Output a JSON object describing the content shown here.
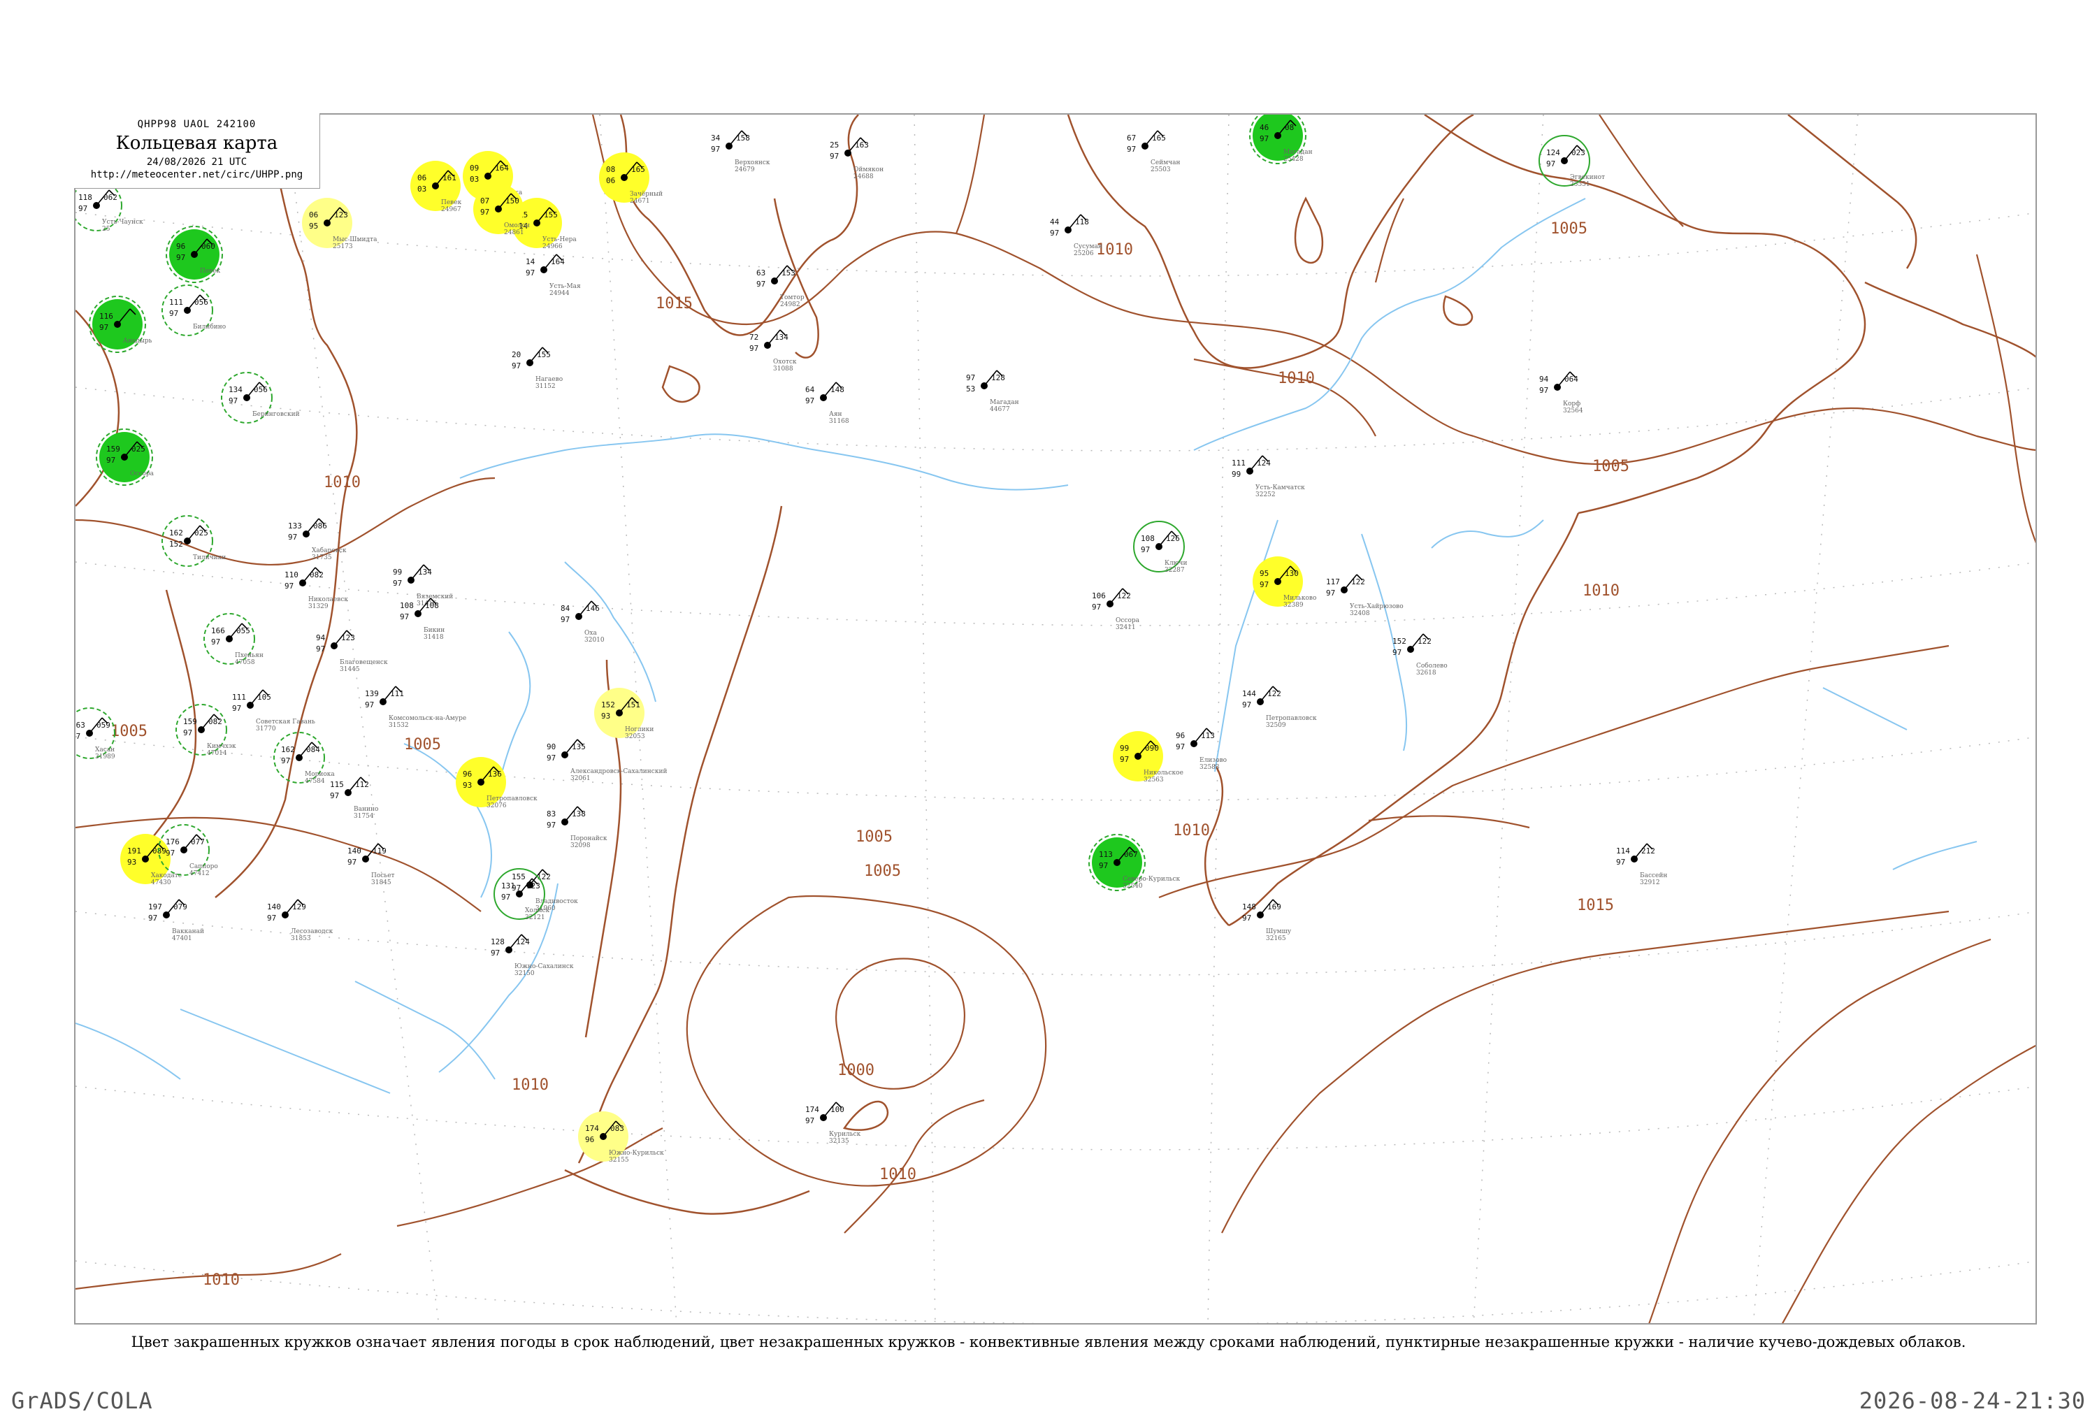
{
  "header": {
    "code": "QHPP98  UAOL  242100",
    "title": "Кольцевая карта",
    "valid_time": "24/08/2026 21 UTC",
    "url": "http://meteocenter.net/circ/UHPP.png"
  },
  "caption": "Цвет закрашенных кружков означает явления погоды в срок наблюдений, цвет незакрашенных кружков - конвективные явления между сроками наблюдений, пунктирные незакрашенные кружки - наличие кучево-дождевых облаков.",
  "footer": {
    "left": "GrADS/COLA",
    "right": "2026-08-24-21:30"
  },
  "colors": {
    "isobar": "#a0522d",
    "coast": "#a0522d",
    "river": "#87c6f0",
    "grid": "#b8b8b8",
    "rain_fill": "#1ec81e",
    "shower_fill": "#ffff2a",
    "light_fill": "#ffff88",
    "cb_dash": "#2ea82e"
  },
  "isobar_labels": [
    "1015",
    "1015",
    "1010",
    "1010",
    "1010",
    "1010",
    "1010",
    "1005",
    "1005",
    "1005",
    "1005",
    "1010",
    "1015",
    "1010",
    "1000",
    "1005",
    "1010",
    "1005",
    "1010"
  ],
  "stations": [
    {
      "name": "Усть-Чаунск",
      "id": "25",
      "t": "118",
      "p": "062",
      "td": "97"
    },
    {
      "name": "Певек",
      "id": "",
      "t": "96",
      "p": "060",
      "td": "97"
    },
    {
      "name": "Билибино",
      "id": "",
      "t": "111",
      "p": "056",
      "td": "97"
    },
    {
      "name": "Анадырь",
      "id": "",
      "t": "116",
      "p": "",
      "td": "97"
    },
    {
      "name": "Беринговский",
      "id": "",
      "t": "134",
      "p": "056",
      "td": "97"
    },
    {
      "name": "Тиличики",
      "id": "",
      "t": "162",
      "p": "025",
      "td": "152"
    },
    {
      "name": "Оссора",
      "id": "",
      "t": "159",
      "p": "025",
      "td": "97"
    },
    {
      "name": "Мыс Шмидта",
      "id": "25173",
      "t": "06",
      "p": "123",
      "td": "95"
    },
    {
      "name": "Певек",
      "id": "24967",
      "t": "06",
      "p": "161",
      "td": "03"
    },
    {
      "name": "Зырянка",
      "id": "24962",
      "t": "09",
      "p": "164",
      "td": "03"
    },
    {
      "name": "Усть-Нера",
      "id": "24966",
      "t": "15",
      "p": "155",
      "td": "14"
    },
    {
      "name": "Зачёрный",
      "id": "24671",
      "t": "08",
      "p": "165",
      "td": "06"
    },
    {
      "name": "Верхоянск",
      "id": "24679",
      "t": "34",
      "p": "158",
      "td": "97"
    },
    {
      "name": "Оймякон",
      "id": "24688",
      "t": "25",
      "p": "163",
      "td": "97"
    },
    {
      "name": "Сеймчан",
      "id": "25503",
      "t": "67",
      "p": "165",
      "td": "97"
    },
    {
      "name": "Магадан",
      "id": "25428",
      "t": "46",
      "p": "08",
      "td": "97"
    },
    {
      "name": "Эгвекинот",
      "id": "25551",
      "t": "124",
      "p": "023",
      "td": "97"
    },
    {
      "name": "Сусуман",
      "id": "25206",
      "t": "44",
      "p": "118",
      "td": "97"
    },
    {
      "name": "Омолон",
      "id": "24861",
      "t": "07",
      "p": "150",
      "td": "97"
    },
    {
      "name": "Усть-Мая",
      "id": "24944",
      "t": "14",
      "p": "164",
      "td": "97"
    },
    {
      "name": "Томтор",
      "id": "24982",
      "t": "63",
      "p": "153",
      "td": "97"
    },
    {
      "name": "Охотск",
      "id": "31088",
      "t": "72",
      "p": "134",
      "td": "97"
    },
    {
      "name": "Нагаево",
      "id": "31152",
      "t": "20",
      "p": "155",
      "td": "97"
    },
    {
      "name": "Аян",
      "id": "31168",
      "t": "64",
      "p": "148",
      "td": "97"
    },
    {
      "name": "Магадан",
      "id": "44677",
      "t": "97",
      "p": "128",
      "td": "53"
    },
    {
      "name": "Корф",
      "id": "32564",
      "t": "94",
      "p": "064",
      "td": "97"
    },
    {
      "name": "Усть-Камчатск",
      "id": "32252",
      "t": "111",
      "p": "124",
      "td": "99"
    },
    {
      "name": "Ключи",
      "id": "32287",
      "t": "108",
      "p": "126",
      "td": "97"
    },
    {
      "name": "Мильково",
      "id": "32389",
      "t": "95",
      "p": "130",
      "td": "97"
    },
    {
      "name": "Усть-Хайрюзово",
      "id": "32408",
      "t": "117",
      "p": "122",
      "td": "97"
    },
    {
      "name": "Оссора",
      "id": "32411",
      "t": "106",
      "p": "122",
      "td": "97"
    },
    {
      "name": "Соболево",
      "id": "32618",
      "t": "152",
      "p": "122",
      "td": "97"
    },
    {
      "name": "Петропавловск",
      "id": "32509",
      "t": "144",
      "p": "122",
      "td": "97"
    },
    {
      "name": "Елизово",
      "id": "32583",
      "t": "96",
      "p": "113",
      "td": "97"
    },
    {
      "name": "Никольское",
      "id": "32563",
      "t": "99",
      "p": "090",
      "td": "97"
    },
    {
      "name": "Северо-Курильск",
      "id": "32540",
      "t": "113",
      "p": "067",
      "td": "97"
    },
    {
      "name": "Шумшу",
      "id": "32165",
      "t": "148",
      "p": "169",
      "td": "97"
    },
    {
      "name": "Бассейн",
      "id": "32912",
      "t": "114",
      "p": "212",
      "td": "97"
    },
    {
      "name": "Курильск",
      "id": "32135",
      "t": "174",
      "p": "100",
      "td": "97"
    },
    {
      "name": "Южно-Курильск",
      "id": "32155",
      "t": "174",
      "p": "083",
      "td": "96"
    },
    {
      "name": "Хабаровск",
      "id": "31735",
      "t": "133",
      "p": "086",
      "td": "97"
    },
    {
      "name": "Николаевск",
      "id": "31329",
      "t": "110",
      "p": "082",
      "td": "97"
    },
    {
      "name": "Вяземский",
      "id": "31416",
      "t": "99",
      "p": "134",
      "td": "97"
    },
    {
      "name": "Бикин",
      "id": "31418",
      "t": "108",
      "p": "108",
      "td": "97"
    },
    {
      "name": "Благовещенск",
      "id": "31445",
      "t": "94",
      "p": "123",
      "td": "97"
    },
    {
      "name": "Комсомольск-на-Амуре",
      "id": "31532",
      "t": "139",
      "p": "111",
      "td": "97"
    },
    {
      "name": "Советская Гавань",
      "id": "31770",
      "t": "111",
      "p": "105",
      "td": "97"
    },
    {
      "name": "Посьет",
      "id": "31845",
      "t": "140",
      "p": "119",
      "td": "97"
    },
    {
      "name": "Ванино",
      "id": "31754",
      "t": "115",
      "p": "112",
      "td": "97"
    },
    {
      "name": "Лесозаводск",
      "id": "31853",
      "t": "140",
      "p": "129",
      "td": "97"
    },
    {
      "name": "Владивосток",
      "id": "31960",
      "t": "155",
      "p": "122",
      "td": "97"
    },
    {
      "name": "Александровск-Сахалинский",
      "id": "32061",
      "t": "90",
      "p": "135",
      "td": "97"
    },
    {
      "name": "Поронайск",
      "id": "32098",
      "t": "83",
      "p": "138",
      "td": "97"
    },
    {
      "name": "Оха",
      "id": "32010",
      "t": "84",
      "p": "146",
      "td": "97"
    },
    {
      "name": "Ноглики",
      "id": "32053",
      "t": "152",
      "p": "151",
      "td": "93"
    },
    {
      "name": "Южно-Сахалинск",
      "id": "32150",
      "t": "128",
      "p": "124",
      "td": "97"
    },
    {
      "name": "Холмск",
      "id": "32121",
      "t": "131",
      "p": "123",
      "td": "97"
    },
    {
      "name": "Петропавловск",
      "id": "32076",
      "t": "96",
      "p": "136",
      "td": "93"
    },
    {
      "name": "Хакодате",
      "id": "47430",
      "t": "191",
      "p": "089",
      "td": "93"
    },
    {
      "name": "Саппоро",
      "id": "47412",
      "t": "176",
      "p": "077",
      "td": "97"
    },
    {
      "name": "Вакканай",
      "id": "47401",
      "t": "197",
      "p": "079",
      "td": "97"
    },
    {
      "name": "Мориока",
      "id": "47584",
      "t": "162",
      "p": "084",
      "td": "97"
    },
    {
      "name": "Пхеньян",
      "id": "47058",
      "t": "166",
      "p": "055",
      "td": "97"
    },
    {
      "name": "Хасан",
      "id": "31989",
      "t": "163",
      "p": "059",
      "td": "97"
    },
    {
      "name": "Кимчхэк",
      "id": "47014",
      "t": "159",
      "p": "082",
      "td": "97"
    }
  ]
}
